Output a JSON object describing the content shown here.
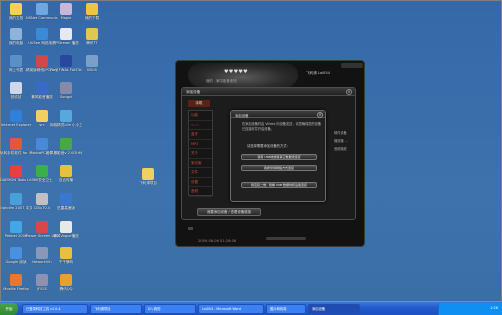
{
  "desktop": {
    "icons": [
      {
        "label": "我的文档",
        "color": "#f5d24a"
      },
      {
        "label": "NSNet Communicator",
        "color": "#6fa8e0"
      },
      {
        "label": "Maple",
        "color": "#c8b8d8"
      },
      {
        "label": "我的下载",
        "color": "#f0c24a"
      },
      {
        "label": "我的电脑",
        "color": "#8fb3d8"
      },
      {
        "label": "UUSee 网络电视",
        "color": "#3b8ad8"
      },
      {
        "label": "PPStream 播放",
        "color": "#e8e8f0"
      },
      {
        "label": "腾讯TT",
        "color": "#e0c850"
      },
      {
        "label": "网上邻居",
        "color": "#5a8fc8"
      },
      {
        "label": "精英版网络(PC)2 可可宝",
        "color": "#d04848"
      },
      {
        "label": "Play FINAL FANTASY XII",
        "color": "#2848a0"
      },
      {
        "label": "KBOS",
        "color": "#7aa0c8"
      },
      {
        "label": "回收站",
        "color": "#d0d8e8"
      },
      {
        "label": "暴风影音播放",
        "color": "#3a6ac8"
      },
      {
        "label": "Songzi",
        "color": "#8888a8"
      },
      {
        "label": "Internet Explorer",
        "color": "#2f7fdb"
      },
      {
        "label": "src",
        "color": "#f0d060"
      },
      {
        "label": "网络精灵Life 小小工具",
        "color": "#58a8e0"
      },
      {
        "label": "玩转手机软件 for iPhone",
        "color": "#e05a3a"
      },
      {
        "label": "NokiaPC套件",
        "color": "#4a88d8"
      },
      {
        "label": "风暴影音v 2.0GHH版",
        "color": "#48a848"
      },
      {
        "label": "DAEMON Tools Lite",
        "color": "#e84040"
      },
      {
        "label": "360安全卫士",
        "color": "#3ab048"
      },
      {
        "label": "百合传输",
        "color": "#e8c040"
      },
      {
        "label": "飞利浦项目",
        "color": "#f0d060"
      },
      {
        "label": "Ophdim 2007 中文版",
        "color": "#48a0d8"
      },
      {
        "label": "CiBuT0.4",
        "color": "#c0c0c0"
      },
      {
        "label": "迅雷高速版",
        "color": "#3a78d0"
      },
      {
        "label": "Pebbel 2008",
        "color": "#40a8e8"
      },
      {
        "label": "Power Screen Video Capture",
        "color": "#d84848"
      },
      {
        "label": "暴风Vogue播放",
        "color": "#e8e8e8"
      },
      {
        "label": "Google 阅读",
        "color": "#4a90e0"
      },
      {
        "label": "NeworkVIn",
        "color": "#8898b8"
      },
      {
        "label": "千千静听",
        "color": "#e8c040"
      },
      {
        "label": "Mozilla Firefox",
        "color": "#e87830"
      },
      {
        "label": "JFSSS",
        "color": "#9090b0"
      },
      {
        "label": "腾讯QQ",
        "color": "#e8a030"
      }
    ]
  },
  "player": {
    "rating": "♥♥♥♥♥",
    "title": "我的 - 家中影音未知",
    "user": "飞利浦 Loi054",
    "timestamp": "2009-06-06  01:26:06"
  },
  "add_device": {
    "title": "添加设备",
    "tab_phone": "手机",
    "nav": [
      "功能",
      "Vpm",
      "蓝牙",
      "MP3",
      "关于",
      "家访客",
      "文件",
      "设置",
      "音频"
    ],
    "right_col": [
      "邮件设备",
      "播放器 ...",
      "音频播放"
    ],
    "bottom_button": "我要添加设备 / 查看设备链接"
  },
  "prompt": {
    "title": "添加设备",
    "message": "在添加设备时由 Vifeed 向设备发送，请您确保您的设备已连接好并开启设备。",
    "question": "请选择需要添加设备的方式：",
    "option1": "我有 USB线或者其它数据线连接",
    "option2": "我希望用网络方式连接",
    "option3": "我直接二维，我看 USB 数据线和设备连接"
  },
  "taskbar": {
    "start": "开始",
    "items": [
      {
        "label": "已登录科技工具 v2.0.4"
      },
      {
        "label": "飞利浦项目"
      },
      {
        "label": "D:\\ 我的"
      },
      {
        "label": "Loi054 - Microsoft Word"
      },
      {
        "label": "图片和传真"
      },
      {
        "label": "添加设备"
      }
    ],
    "clock": "1:26"
  }
}
